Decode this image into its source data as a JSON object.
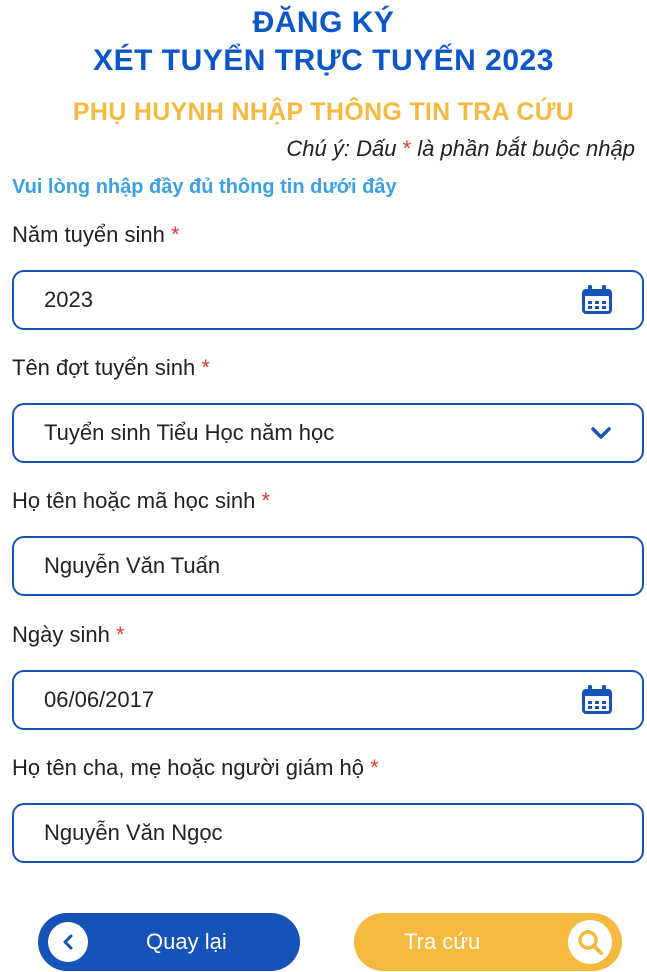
{
  "header": {
    "title_line1": "ĐĂNG KÝ",
    "title_line2": "XÉT TUYỂN TRỰC TUYẾN 2023",
    "subtitle": "PHỤ HUYNH NHẬP THÔNG TIN TRA CỨU",
    "note_prefix": "Chú ý: Dấu",
    "note_star": "*",
    "note_suffix": "là phần bắt buộc nhập",
    "hint": "Vui lòng nhập đầy đủ thông tin dưới đây"
  },
  "form": {
    "required_mark": "*",
    "year": {
      "label": "Năm tuyển sinh",
      "value": "2023",
      "icon": "calendar-icon"
    },
    "round": {
      "label": "Tên đợt tuyển sinh",
      "value": "Tuyển sinh Tiểu Học năm học",
      "icon": "chevron-down-icon"
    },
    "student": {
      "label": "Họ tên hoặc mã học sinh",
      "value": "Nguyễn Văn Tuấn"
    },
    "dob": {
      "label": "Ngày sinh",
      "value": "06/06/2017",
      "icon": "calendar-icon"
    },
    "guardian": {
      "label": "Họ tên cha, mẹ hoặc người giám hộ",
      "value": "Nguyễn Văn Ngọc"
    }
  },
  "actions": {
    "back_label": "Quay lại",
    "search_label": "Tra cứu"
  },
  "colors": {
    "primary": "#1553b8",
    "accent": "#f6b940",
    "hint": "#3aa1e6",
    "required": "#e53935"
  }
}
